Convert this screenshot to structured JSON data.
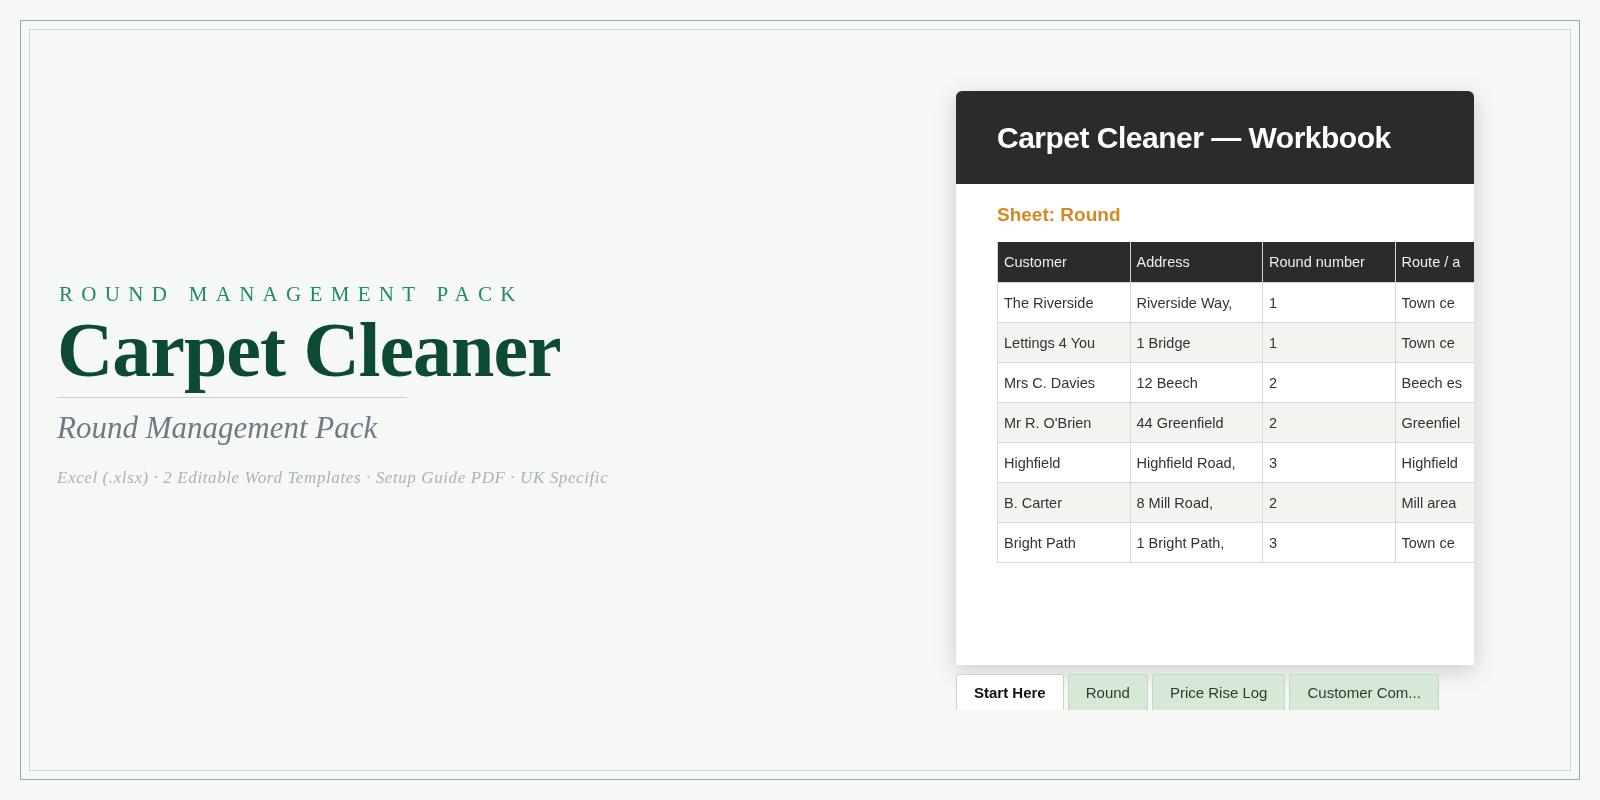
{
  "hero": {
    "eyebrow": "ROUND MANAGEMENT PACK",
    "title": "Carpet Cleaner",
    "subtitle": "Round Management Pack",
    "features": "Excel (.xlsx) · 2 Editable Word Templates · Setup Guide PDF · UK Specific"
  },
  "workbook": {
    "title": "Carpet Cleaner — Workbook",
    "sheet_label": "Sheet: Round",
    "table": {
      "columns": [
        "Customer",
        "Address",
        "Round number",
        "Route / a"
      ],
      "rows": [
        [
          "The Riverside",
          "Riverside Way,",
          "1",
          "Town ce"
        ],
        [
          "Lettings 4 You",
          "1 Bridge",
          "1",
          "Town ce"
        ],
        [
          "Mrs C. Davies",
          "12 Beech",
          "2",
          "Beech es"
        ],
        [
          "Mr R. O'Brien",
          "44 Greenfield",
          "2",
          "Greenfiel"
        ],
        [
          "Highfield",
          "Highfield Road,",
          "3",
          "Highfield"
        ],
        [
          "B. Carter",
          "8 Mill Road,",
          "2",
          "Mill area"
        ],
        [
          "Bright Path",
          "1 Bright Path,",
          "3",
          "Town ce"
        ]
      ]
    },
    "tabs": [
      {
        "label": "Start Here",
        "selected": true
      },
      {
        "label": "Round",
        "selected": false
      },
      {
        "label": "Price Rise Log",
        "selected": false
      },
      {
        "label": "Customer Com...",
        "selected": false
      }
    ]
  }
}
